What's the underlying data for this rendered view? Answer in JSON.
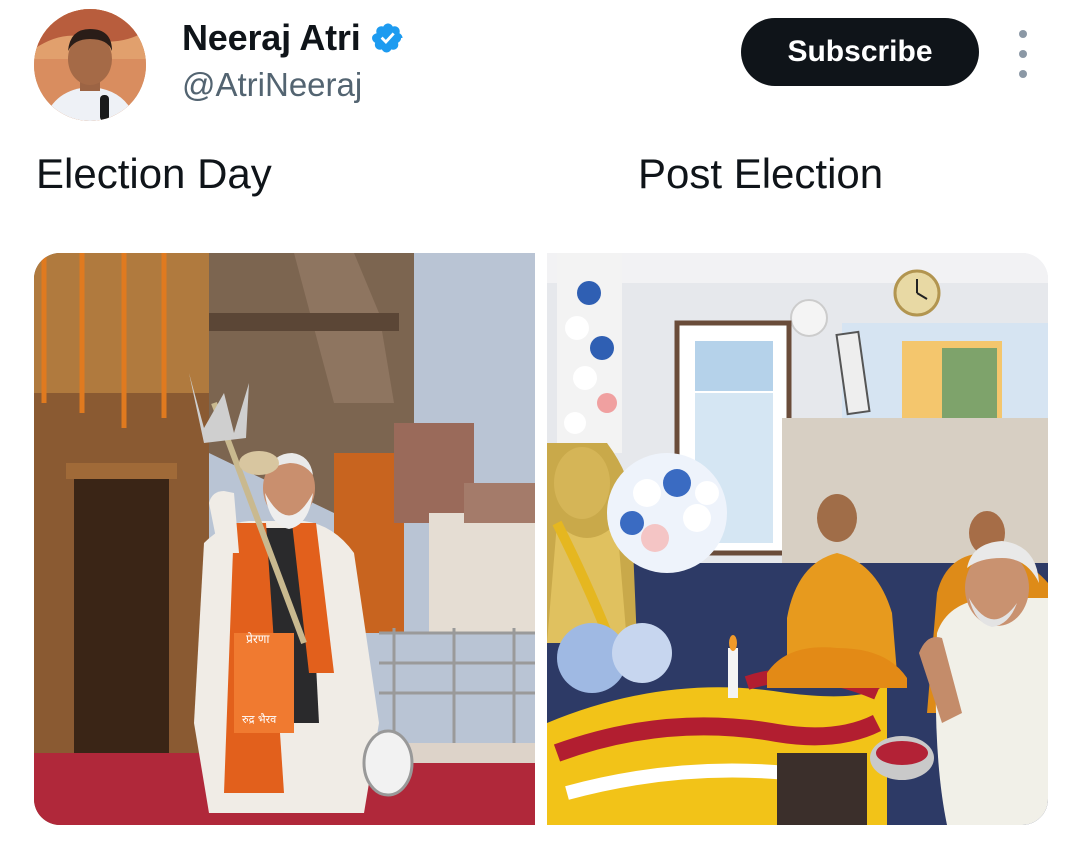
{
  "author": {
    "display_name": "Neeraj Atri",
    "handle": "@AtriNeeraj",
    "verified": true,
    "verified_color": "#1d9bf0"
  },
  "actions": {
    "subscribe_label": "Subscribe",
    "more_icon": "more-vertical-icon"
  },
  "tweet": {
    "captions": {
      "left": "Election Day",
      "right": "Post Election"
    }
  },
  "media": {
    "photos": [
      {
        "subject": "temple-scene-photo",
        "burned_in_text": [
          "प्रेरणा",
          "रुद्र भैरव"
        ]
      },
      {
        "subject": "prayer-room-photo"
      }
    ]
  },
  "colors": {
    "text_primary": "#0f1419",
    "text_secondary": "#536471",
    "button_bg": "#0f1419",
    "button_text": "#ffffff"
  }
}
